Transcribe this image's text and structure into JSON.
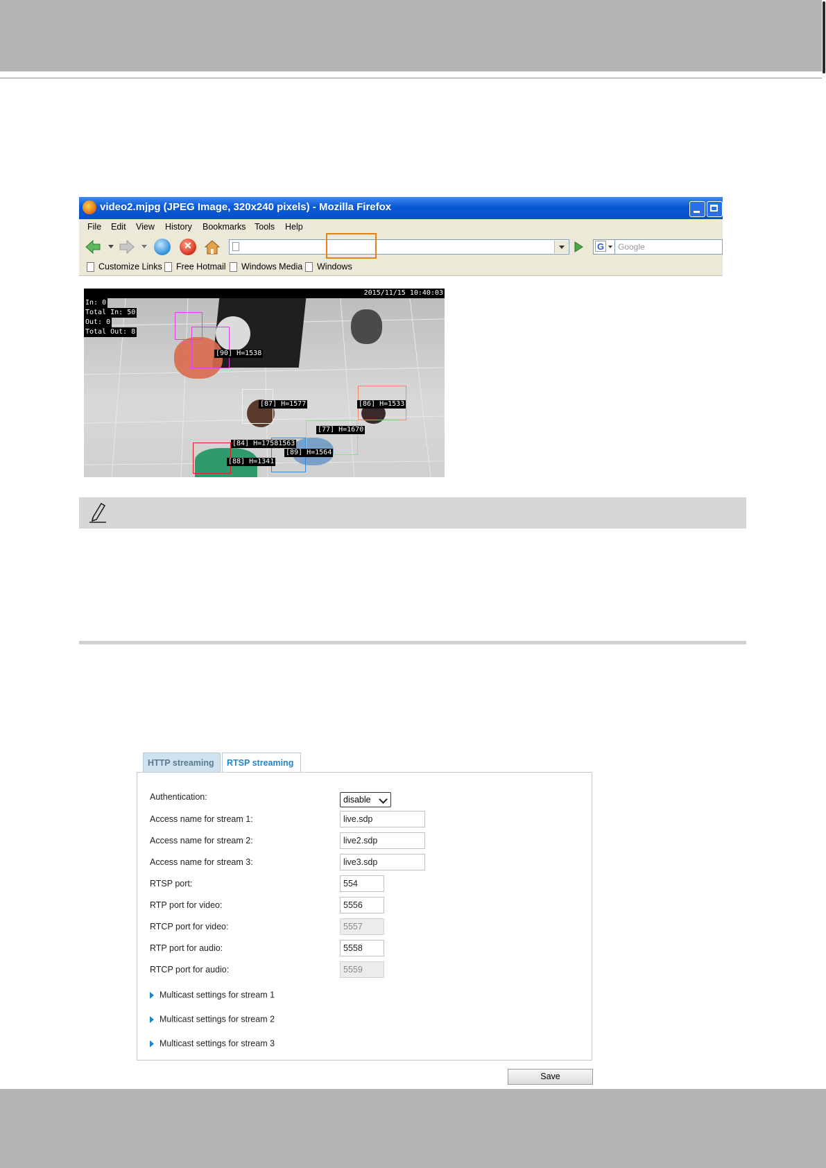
{
  "firefox": {
    "title": "video2.mjpg (JPEG Image, 320x240 pixels) - Mozilla Firefox",
    "menu": [
      "File",
      "Edit",
      "View",
      "History",
      "Bookmarks",
      "Tools",
      "Help"
    ],
    "search_placeholder": "Google",
    "search_engine_glyph": "G",
    "bookmarks": [
      "Customize Links",
      "Free Hotmail",
      "Windows Media",
      "Windows"
    ]
  },
  "camera": {
    "timestamp": "2015/11/15 10:40:03",
    "counts": [
      "In: 0",
      "Total In: 50",
      "Out: 0",
      "Total Out: 8"
    ],
    "track_labels": [
      "[90] H=1538",
      "[87] H=1577",
      "[86] H=1533",
      "[77] H=1670",
      "[84] H=17581563",
      "[89] H=1564",
      "[88] H=1341"
    ]
  },
  "rtsp": {
    "tabs": [
      "HTTP streaming",
      "RTSP streaming"
    ],
    "authentication_label": "Authentication:",
    "authentication_value": "disable",
    "rows": [
      {
        "label": "Access name for stream 1:",
        "value": "live.sdp"
      },
      {
        "label": "Access name for stream 2:",
        "value": "live2.sdp"
      },
      {
        "label": "Access name for stream 3:",
        "value": "live3.sdp"
      },
      {
        "label": "RTSP port:",
        "value": "554"
      },
      {
        "label": "RTP port for video:",
        "value": "5556"
      },
      {
        "label": "RTCP port for video:",
        "value": "5557"
      },
      {
        "label": "RTP port for audio:",
        "value": "5558"
      },
      {
        "label": "RTCP port for audio:",
        "value": "5559"
      }
    ],
    "multicast_links": [
      "Multicast settings for stream 1",
      "Multicast settings for stream 2",
      "Multicast settings for stream 3"
    ],
    "save_label": "Save"
  },
  "colors": {
    "page_band": "#b3b3b3",
    "xp_title_blue": "#0a58d6",
    "active_tab_text": "#1b87c9",
    "url_highlight": "#e0821c"
  }
}
